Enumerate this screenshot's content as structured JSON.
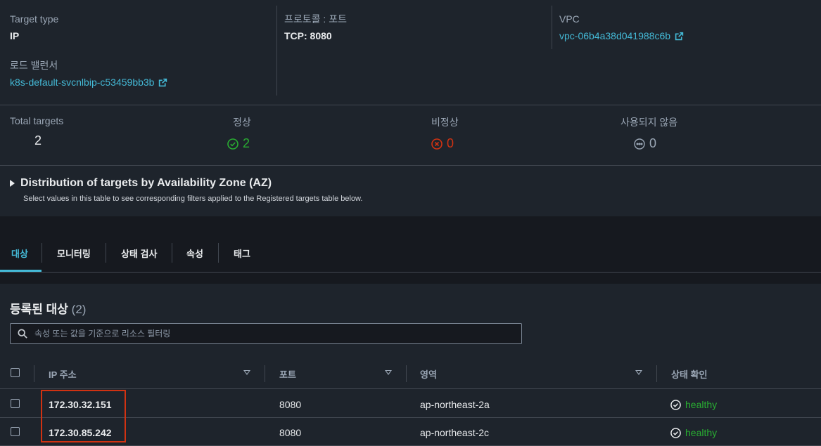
{
  "details": {
    "target_type_label": "Target type",
    "target_type_value": "IP",
    "protocol_label": "프로토콜 : 포트",
    "protocol_value": "TCP: 8080",
    "vpc_label": "VPC",
    "vpc_value": "vpc-06b4a38d041988c6b",
    "lb_label": "로드 밸런서",
    "lb_value": "k8s-default-svcnlbip-c53459bb3b"
  },
  "summary": {
    "total_label": "Total targets",
    "total_value": "2",
    "healthy_label": "정상",
    "healthy_value": "2",
    "unhealthy_label": "비정상",
    "unhealthy_value": "0",
    "unused_label": "사용되지 않음",
    "unused_value": "0"
  },
  "distribution": {
    "title": "Distribution of targets by Availability Zone (AZ)",
    "subtitle": "Select values in this table to see corresponding filters applied to the Registered targets table below."
  },
  "tabs": [
    "대상",
    "모니터링",
    "상태 검사",
    "속성",
    "태그"
  ],
  "registered": {
    "title": "등록된 대상",
    "count": "(2)",
    "search_placeholder": "속성 또는 값을 기준으로 리소스 필터링",
    "columns": [
      "IP 주소",
      "포트",
      "영역",
      "상태 확인"
    ],
    "rows": [
      {
        "ip": "172.30.32.151",
        "port": "8080",
        "zone": "ap-northeast-2a",
        "health": "healthy"
      },
      {
        "ip": "172.30.85.242",
        "port": "8080",
        "zone": "ap-northeast-2c",
        "health": "healthy"
      }
    ]
  },
  "colors": {
    "link": "#44b9d6",
    "healthy": "#29ad32",
    "unhealthy": "#d13212",
    "highlight": "#d13212"
  }
}
